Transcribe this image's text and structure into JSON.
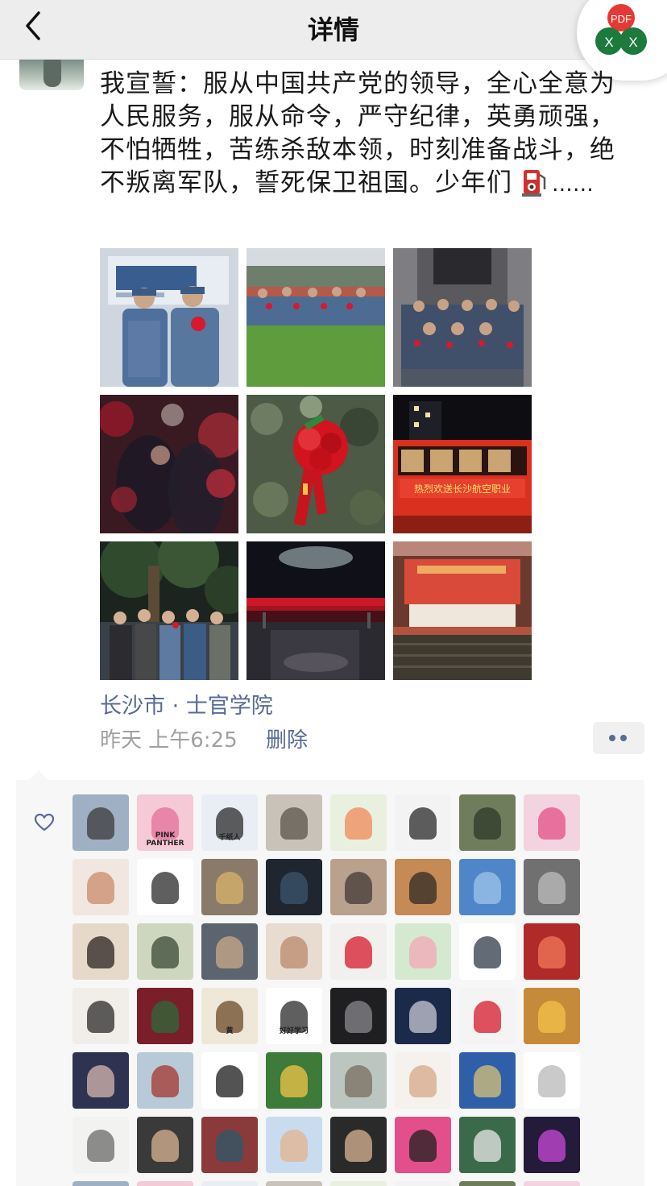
{
  "nav": {
    "title": "详情",
    "widget_badge": "PDF",
    "widget_x1": "X",
    "widget_x2": "X"
  },
  "post": {
    "text": "我宣誓：服从中国共产党的领导，全心全意为人民服务，服从命令，严守纪律，英勇顽强，不怕牺牲，苦练杀敌本领，时刻准备战斗，绝不叛离军队，誓死保卫祖国。少年们",
    "ellipsis": "……",
    "emoji": "fuel-pump-emoji",
    "location": "长沙市 · 士官学院",
    "timestamp": "昨天 上午6:25",
    "delete_label": "删除"
  },
  "photos": {
    "banner_text": "热烈欢送长沙航空职业",
    "items": [
      "recruit-portrait",
      "field-group",
      "indoor-group",
      "night-crowd",
      "red-flower-badge",
      "bus-banner",
      "tree-group",
      "night-street",
      "auditorium"
    ]
  },
  "likes": {
    "icon": "heart-icon",
    "avatar_texts": {
      "pink_panther": "PINK PANTHER",
      "qianzhiren": "千纸人",
      "huang": "黄",
      "haohao_xuexi": "好好学习"
    }
  },
  "colors": {
    "link": "#576b95",
    "nav_bg": "#ededed",
    "likes_bg": "#f7f7f7",
    "timestamp": "#a0a0a0"
  }
}
